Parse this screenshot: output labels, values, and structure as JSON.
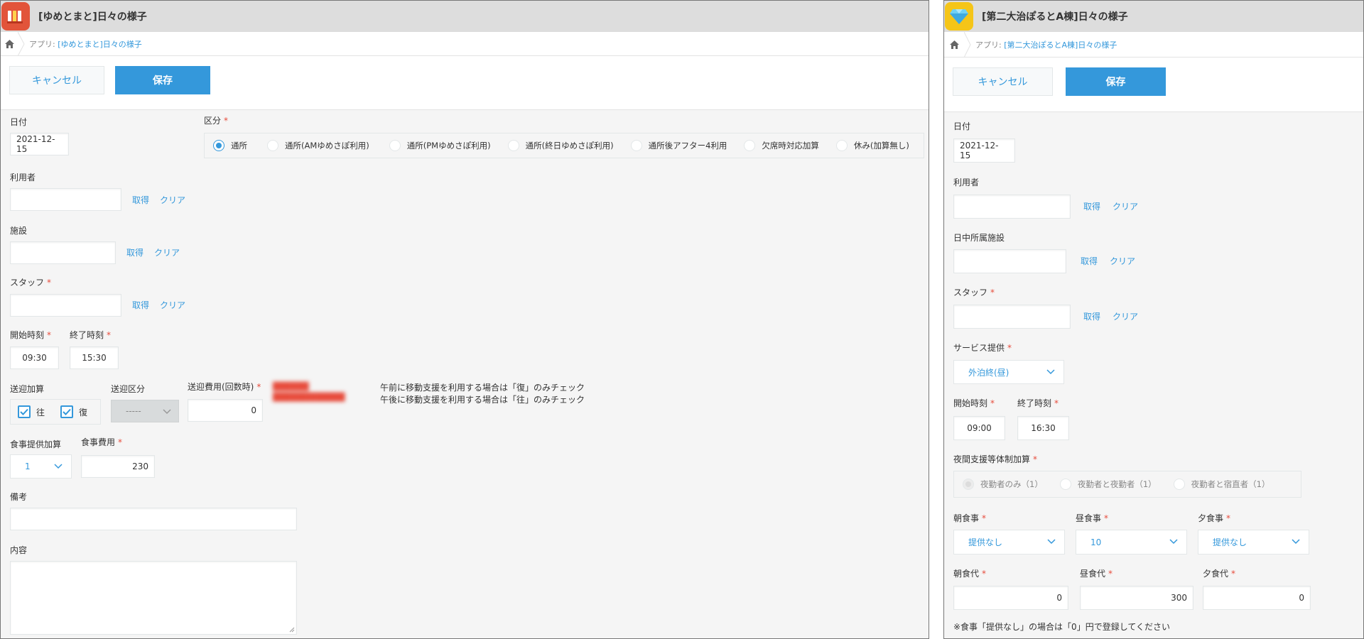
{
  "left": {
    "title": "[ゆめとまと]日々の様子",
    "breadcrumb_prefix": "アプリ:",
    "breadcrumb_app": "[ゆめとまと]日々の様子",
    "cancel_label": "キャンセル",
    "save_label": "保存",
    "date_label": "日付",
    "date_value": "2021-12-15",
    "category_label": "区分",
    "category_options": [
      "通所",
      "通所(AMゆめさぽ利用)",
      "通所(PMゆめさぽ利用)",
      "通所(終日ゆめさぽ利用)",
      "通所後アフター4利用",
      "欠席時対応加算",
      "休み(加算無し)"
    ],
    "category_selected": "通所",
    "user_label": "利用者",
    "facility_label": "施設",
    "staff_label": "スタッフ",
    "get_label": "取得",
    "clear_label": "クリア",
    "start_label": "開始時刻",
    "start_value": "09:30",
    "end_label": "終了時刻",
    "end_value": "15:30",
    "transport_add_label": "送迎加算",
    "transport_go": "往",
    "transport_return": "復",
    "transport_type_label": "送迎区分",
    "transport_type_value": "-----",
    "transport_fee_label": "送迎費用(回数時)",
    "transport_fee_value": "0",
    "transport_note_1": "午前に移動支援を利用する場合は「復」のみチェック",
    "transport_note_2": "午後に移動支援を利用する場合は「往」のみチェック",
    "meal_add_label": "食事提供加算",
    "meal_add_value": "1",
    "meal_fee_label": "食事費用",
    "meal_fee_value": "230",
    "remarks_label": "備考",
    "content_label": "内容"
  },
  "right": {
    "title": "[第二大治ぽるとA棟]日々の様子",
    "breadcrumb_prefix": "アプリ:",
    "breadcrumb_app": "[第二大治ぽるとA棟]日々の様子",
    "cancel_label": "キャンセル",
    "save_label": "保存",
    "date_label": "日付",
    "date_value": "2021-12-15",
    "user_label": "利用者",
    "day_facility_label": "日中所属施設",
    "staff_label": "スタッフ",
    "get_label": "取得",
    "clear_label": "クリア",
    "service_label": "サービス提供",
    "service_value": "外泊終(昼)",
    "start_label": "開始時刻",
    "start_value": "09:00",
    "end_label": "終了時刻",
    "end_value": "16:30",
    "night_label": "夜間支援等体制加算",
    "night_options": [
      "夜勤者のみ（1）",
      "夜勤者と夜勤者（1）",
      "夜勤者と宿直者（1）"
    ],
    "breakfast_label": "朝食事",
    "breakfast_value": "提供なし",
    "lunch_label": "昼食事",
    "lunch_value": "10",
    "dinner_label": "夕食事",
    "dinner_value": "提供なし",
    "breakfast_fee_label": "朝食代",
    "breakfast_fee_value": "0",
    "lunch_fee_label": "昼食代",
    "lunch_fee_value": "300",
    "dinner_fee_label": "夕食代",
    "dinner_fee_value": "0",
    "meal_note": "※食事「提供なし」の場合は「0」円で登録してください"
  }
}
